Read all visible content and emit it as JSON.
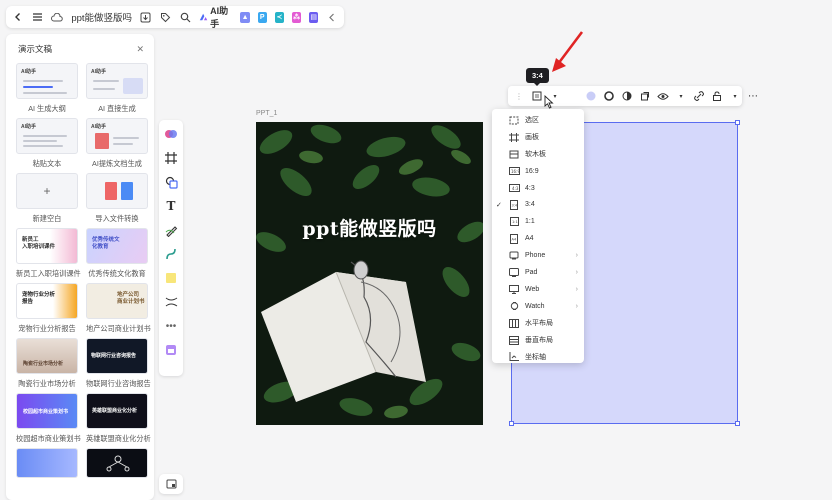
{
  "topbar": {
    "doc_title": "ppt能做竖版吗",
    "ai_label": "AI助手"
  },
  "left_panel": {
    "title": "演示文稿",
    "tiles": [
      {
        "label": "AI 生成大纲",
        "thumb_text": "AI助手"
      },
      {
        "label": "AI 直接生成",
        "thumb_text": "AI助手"
      },
      {
        "label": "粘贴文本",
        "thumb_text": "AI助手"
      },
      {
        "label": "AI提炼文档生成",
        "thumb_text": "AI助手"
      },
      {
        "label": "新建空白",
        "thumb_text": "+"
      },
      {
        "label": "导入文件转换",
        "thumb_text": ""
      },
      {
        "label": "新员工入职培训课件",
        "thumb_text": "新员工\n入职培训课件"
      },
      {
        "label": "优秀传统文化教育",
        "thumb_text": "优秀传统文\n化教育"
      },
      {
        "label": "宠物行业分析报告",
        "thumb_text": "宠物行业分析\n报告"
      },
      {
        "label": "地产公司商业计划书",
        "thumb_text": "地产公司\n商业计划书"
      },
      {
        "label": "陶瓷行业市场分析",
        "thumb_text": "陶瓷行业市场分析"
      },
      {
        "label": "物联网行业咨询报告",
        "thumb_text": "物联网行业咨询报告"
      },
      {
        "label": "校园超市商业策划书",
        "thumb_text": "校园超市商业策划书"
      },
      {
        "label": "英雄联盟商业化分析",
        "thumb_text": "英雄联盟商业化分析"
      }
    ]
  },
  "canvas": {
    "page_label": "PPT_1",
    "slide_title": "ppt能做竖版吗"
  },
  "tooltip": "3:4",
  "dropdown": {
    "items": [
      {
        "label": "选区",
        "checked": false,
        "submenu": false
      },
      {
        "label": "画板",
        "checked": false,
        "submenu": false
      },
      {
        "label": "软木板",
        "checked": false,
        "submenu": false
      },
      {
        "label": "16:9",
        "checked": false,
        "submenu": false
      },
      {
        "label": "4:3",
        "checked": false,
        "submenu": false
      },
      {
        "label": "3:4",
        "checked": true,
        "submenu": false
      },
      {
        "label": "1:1",
        "checked": false,
        "submenu": false
      },
      {
        "label": "A4",
        "checked": false,
        "submenu": false
      },
      {
        "label": "Phone",
        "checked": false,
        "submenu": true
      },
      {
        "label": "Pad",
        "checked": false,
        "submenu": true
      },
      {
        "label": "Web",
        "checked": false,
        "submenu": true
      },
      {
        "label": "Watch",
        "checked": false,
        "submenu": true
      },
      {
        "label": "水平布局",
        "checked": false,
        "submenu": false
      },
      {
        "label": "垂直布局",
        "checked": false,
        "submenu": false
      },
      {
        "label": "坐标轴",
        "checked": false,
        "submenu": false
      }
    ]
  },
  "colors": {
    "accent": "#5a6cf0",
    "frame_fill": "#d5d8fb",
    "arrow": "#e02424"
  }
}
